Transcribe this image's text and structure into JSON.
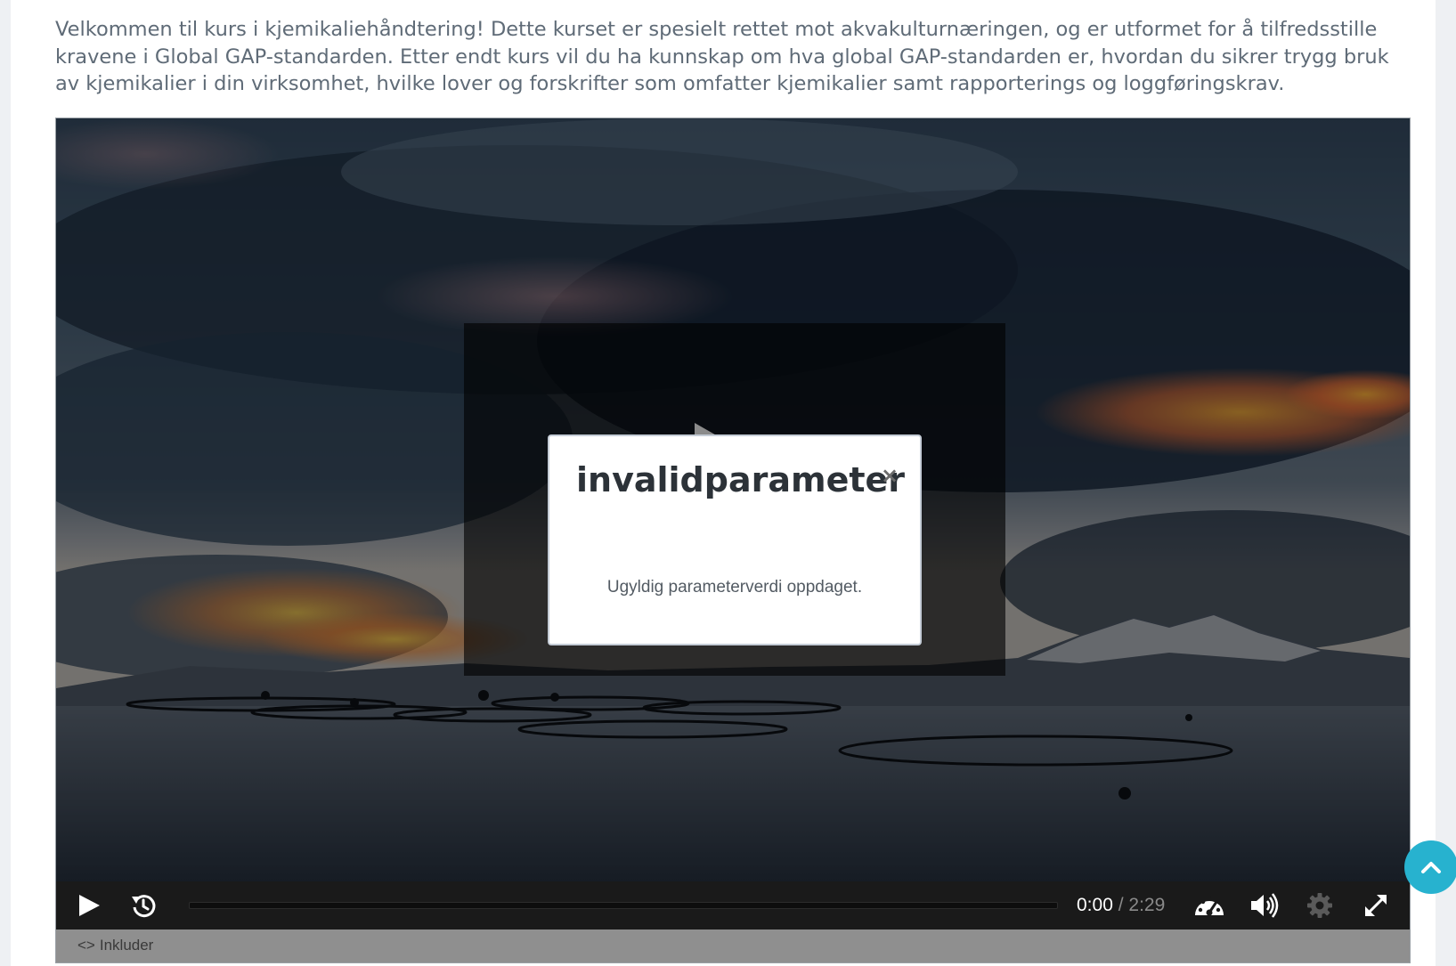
{
  "intro": {
    "text": "Velkommen til kurs i kjemikaliehåndtering! Dette kurset er spesielt rettet mot akvakulturnæringen, og er utformet for å tilfredsstille kravene i Global GAP-standarden. Etter endt kurs vil du ha kunnskap om hva global GAP-standarden er, hvordan du sikrer trygg bruk av kjemikalier i din virksomhet, hvilke lover og forskrifter som omfatter kjemikalier samt rapporterings og loggføringskrav."
  },
  "dialog": {
    "title": "invalidparameter",
    "close_glyph": "×",
    "message": "Ugyldig parameterverdi oppdaget."
  },
  "player": {
    "time_current": "0:00",
    "time_separator": "/",
    "time_total": "2:29",
    "progress": 0,
    "embed_glyph": "<>",
    "embed_label": "Inkluder"
  },
  "icons": {
    "play": "play-icon",
    "rewind": "rewind-icon",
    "speed": "speedometer-icon",
    "volume": "volume-icon",
    "settings": "gear-icon",
    "fullscreen": "fullscreen-icon",
    "scroll_top": "chevron-up-icon"
  },
  "colors": {
    "accent": "#27b2cf",
    "control_bar": "#1a1a1a",
    "embed_bar": "#8f8f8f"
  }
}
